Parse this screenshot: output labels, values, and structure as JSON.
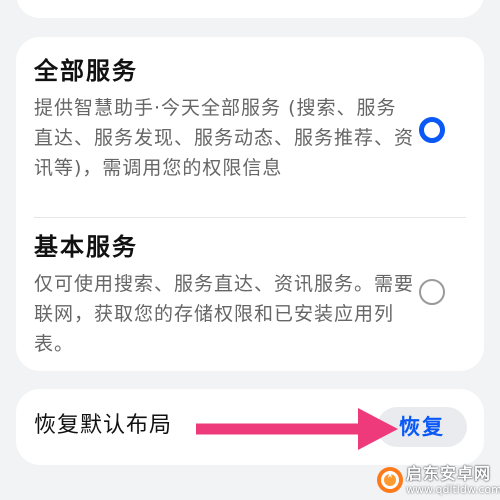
{
  "services": {
    "full": {
      "title": "全部服务",
      "description": "提供智慧助手·今天全部服务 (搜索、服务直达、服务发现、服务动态、服务推荐、资讯等)，需调用您的权限信息",
      "selected": true
    },
    "basic": {
      "title": "基本服务",
      "description": "仅可使用搜索、服务直达、资讯服务。需要联网，获取您的存储权限和已安装应用列表。",
      "selected": false
    }
  },
  "restore": {
    "label": "恢复默认布局",
    "button_label": "恢复"
  },
  "colors": {
    "accent": "#0a59f7",
    "arrow": "#ee3a7b",
    "background": "#f1f3f5"
  },
  "watermark": {
    "brand": "启东安卓网",
    "url": "www.qdltldw.com"
  }
}
